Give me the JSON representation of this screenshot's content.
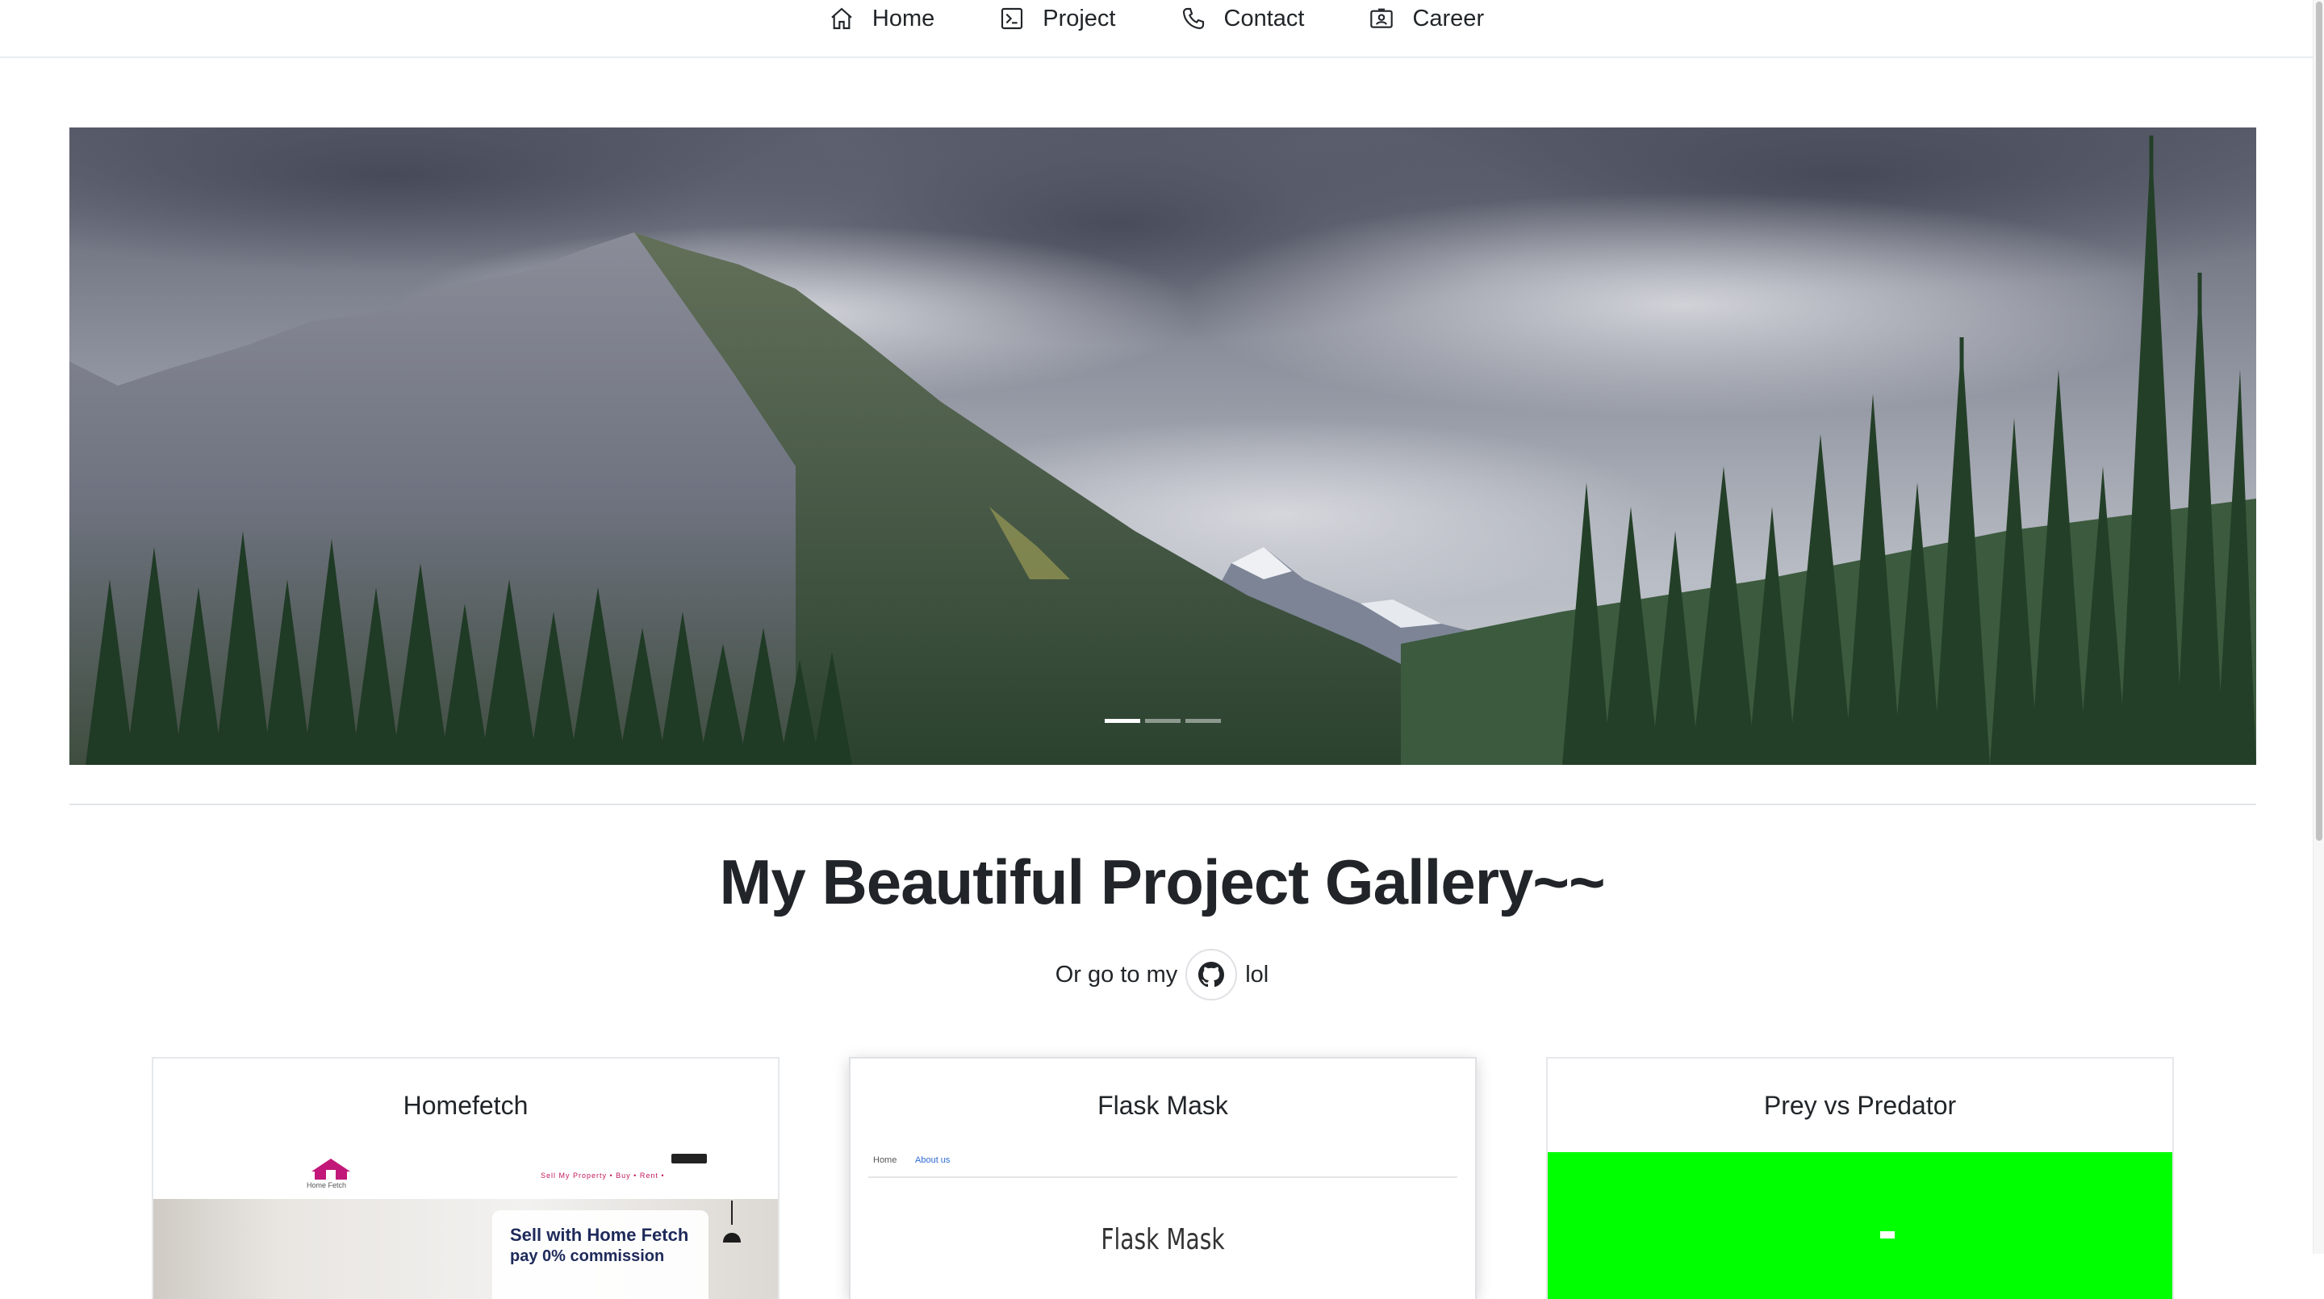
{
  "nav": {
    "items": [
      {
        "label": "Home",
        "icon": "home-icon"
      },
      {
        "label": "Project",
        "icon": "terminal-icon"
      },
      {
        "label": "Contact",
        "icon": "phone-icon"
      },
      {
        "label": "Career",
        "icon": "id-card-icon"
      }
    ]
  },
  "carousel": {
    "slide_count": 3,
    "active_index": 0,
    "image": "mountain-forest-landscape"
  },
  "gallery": {
    "title": "My Beautiful Project Gallery~~",
    "sub_prefix": "Or go to my",
    "sub_suffix": "lol",
    "github_icon": "github-icon"
  },
  "cards": [
    {
      "title": "Homefetch",
      "thumb": {
        "logo_text": "Home Fetch",
        "links": "Sell My Property  •   Buy  •   Rent  •",
        "headline": "Sell with Home Fetch",
        "subline": "pay 0% commission"
      }
    },
    {
      "title": "Flask Mask",
      "thumb": {
        "nav_home": "Home",
        "nav_about": "About us",
        "heading": "Flask Mask"
      }
    },
    {
      "title": "Prey vs Predator",
      "thumb": {
        "background": "#00ff00"
      }
    }
  ]
}
